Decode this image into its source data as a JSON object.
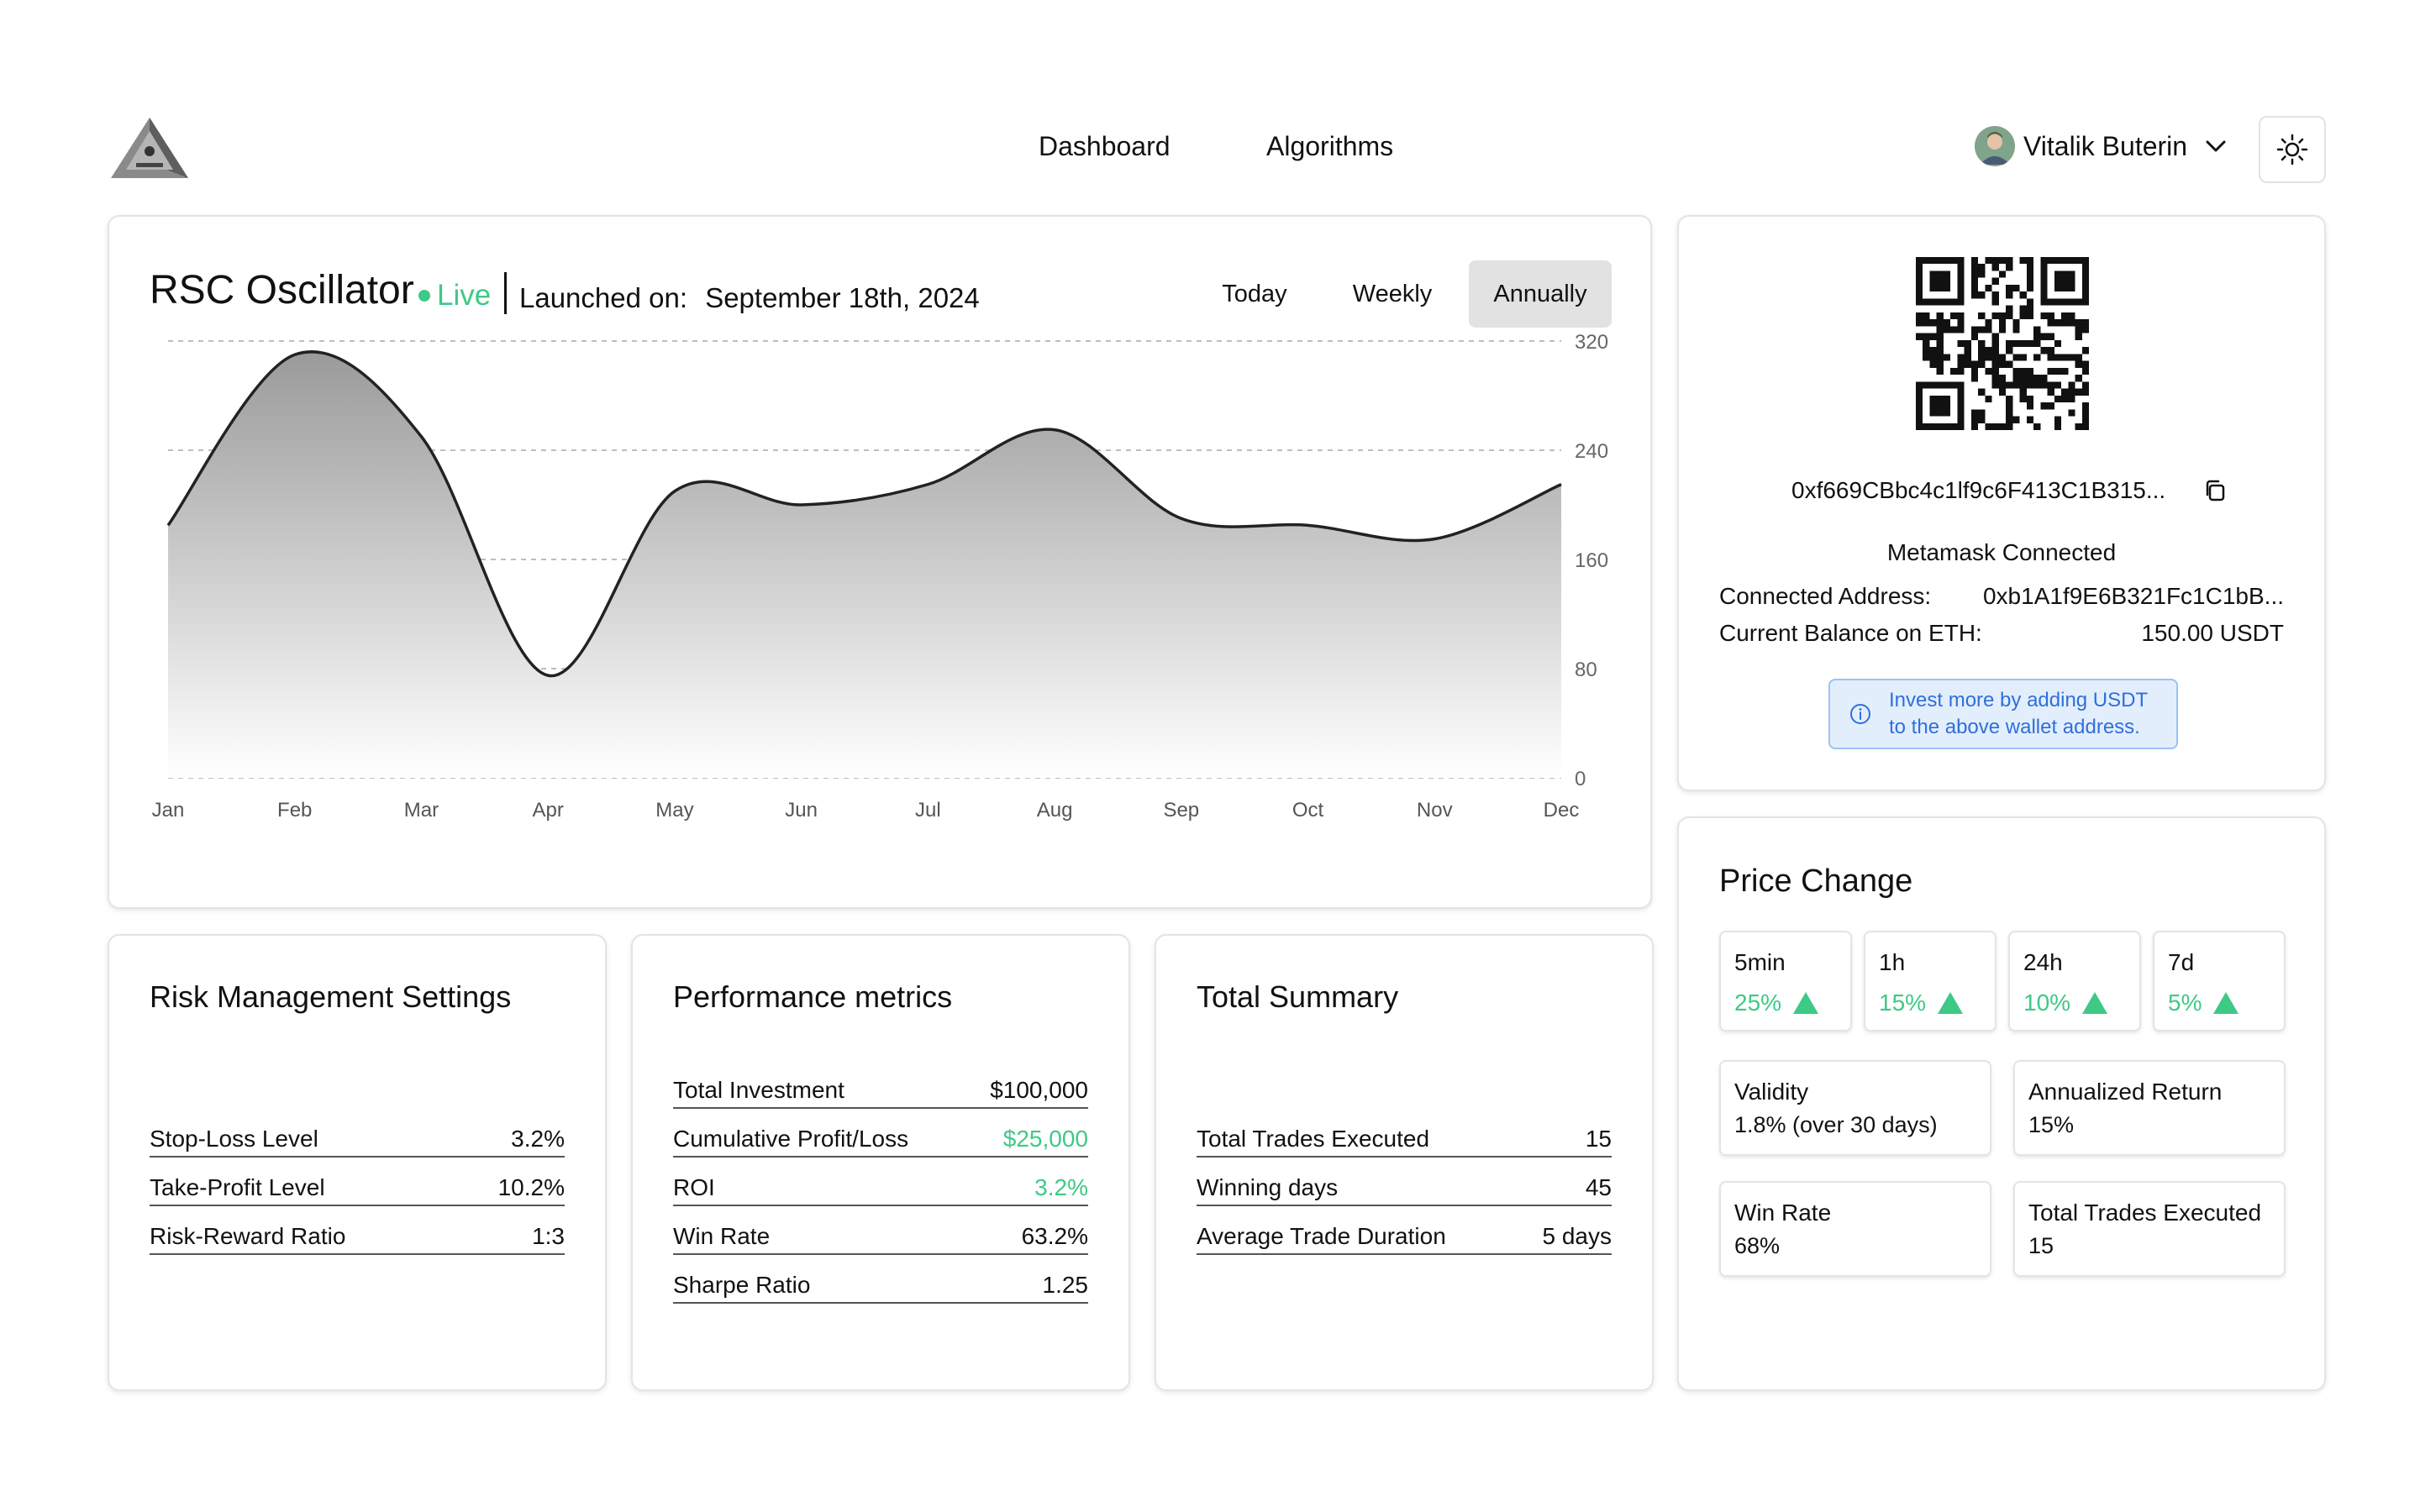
{
  "header": {
    "nav": [
      "Dashboard",
      "Algorithms"
    ],
    "user_name": "Vitalik Buterin",
    "theme_icon": "sun-icon"
  },
  "chart_card": {
    "title": "RSC Oscillator",
    "live_label": "Live",
    "launched_label": "Launched on:",
    "launched_date": "September 18th, 2024",
    "ranges": [
      "Today",
      "Weekly",
      "Annually"
    ],
    "active_range": "Annually"
  },
  "chart_data": {
    "type": "area",
    "x": [
      "Jan",
      "Feb",
      "Mar",
      "Apr",
      "May",
      "Jun",
      "Jul",
      "Aug",
      "Sep",
      "Oct",
      "Nov",
      "Dec"
    ],
    "series": [
      {
        "values": [
          185,
          310,
          250,
          75,
          210,
          200,
          215,
          255,
          190,
          185,
          175,
          215
        ]
      }
    ],
    "yticks": [
      0,
      80,
      160,
      240,
      320
    ],
    "ylim": [
      0,
      320
    ],
    "grid": true,
    "colors": {
      "line": "#222222",
      "fill_top": "#9a9a9a",
      "fill_bottom": "#ffffff",
      "grid": "#bdbdbd"
    }
  },
  "wallet": {
    "address_short": "0xf669CBbc4c1lf9c6F413C1B315...",
    "status": "Metamask Connected",
    "connected_label": "Connected Address:",
    "connected_value": "0xb1A1f9E6B321Fc1C1bB...",
    "balance_label": "Current Balance on ETH:",
    "balance_value": "150.00 USDT",
    "info_line1": "Invest more by adding USDT",
    "info_line2": "to the above wallet address."
  },
  "risk": {
    "title": "Risk Management Settings",
    "rows": [
      {
        "label": "Stop-Loss Level",
        "value": "3.2%"
      },
      {
        "label": "Take-Profit Level",
        "value": "10.2%"
      },
      {
        "label": "Risk-Reward Ratio",
        "value": "1:3"
      }
    ]
  },
  "performance": {
    "title": "Performance metrics",
    "rows": [
      {
        "label": "Total Investment",
        "value": "$100,000"
      },
      {
        "label": "Cumulative Profit/Loss",
        "value": "$25,000"
      },
      {
        "label": "ROI",
        "value": "3.2%"
      },
      {
        "label": "Win Rate",
        "value": "63.2%"
      },
      {
        "label": "Sharpe Ratio",
        "value": "1.25"
      }
    ]
  },
  "summary": {
    "title": "Total Summary",
    "rows": [
      {
        "label": "Total Trades Executed",
        "value": "15"
      },
      {
        "label": "Winning days",
        "value": "45"
      },
      {
        "label": "Average Trade Duration",
        "value": "5 days"
      }
    ]
  },
  "price_change": {
    "title": "Price Change",
    "items": [
      {
        "label": "5min",
        "value": "25%"
      },
      {
        "label": "1h",
        "value": "15%"
      },
      {
        "label": "24h",
        "value": "10%"
      },
      {
        "label": "7d",
        "value": "5%"
      }
    ],
    "stats": [
      {
        "label": "Validity",
        "value": "1.8% (over 30 days)"
      },
      {
        "label": "Annualized Return",
        "value": "15%"
      },
      {
        "label": "Win Rate",
        "value": "68%"
      },
      {
        "label": "Total Trades Executed",
        "value": "15"
      }
    ]
  }
}
